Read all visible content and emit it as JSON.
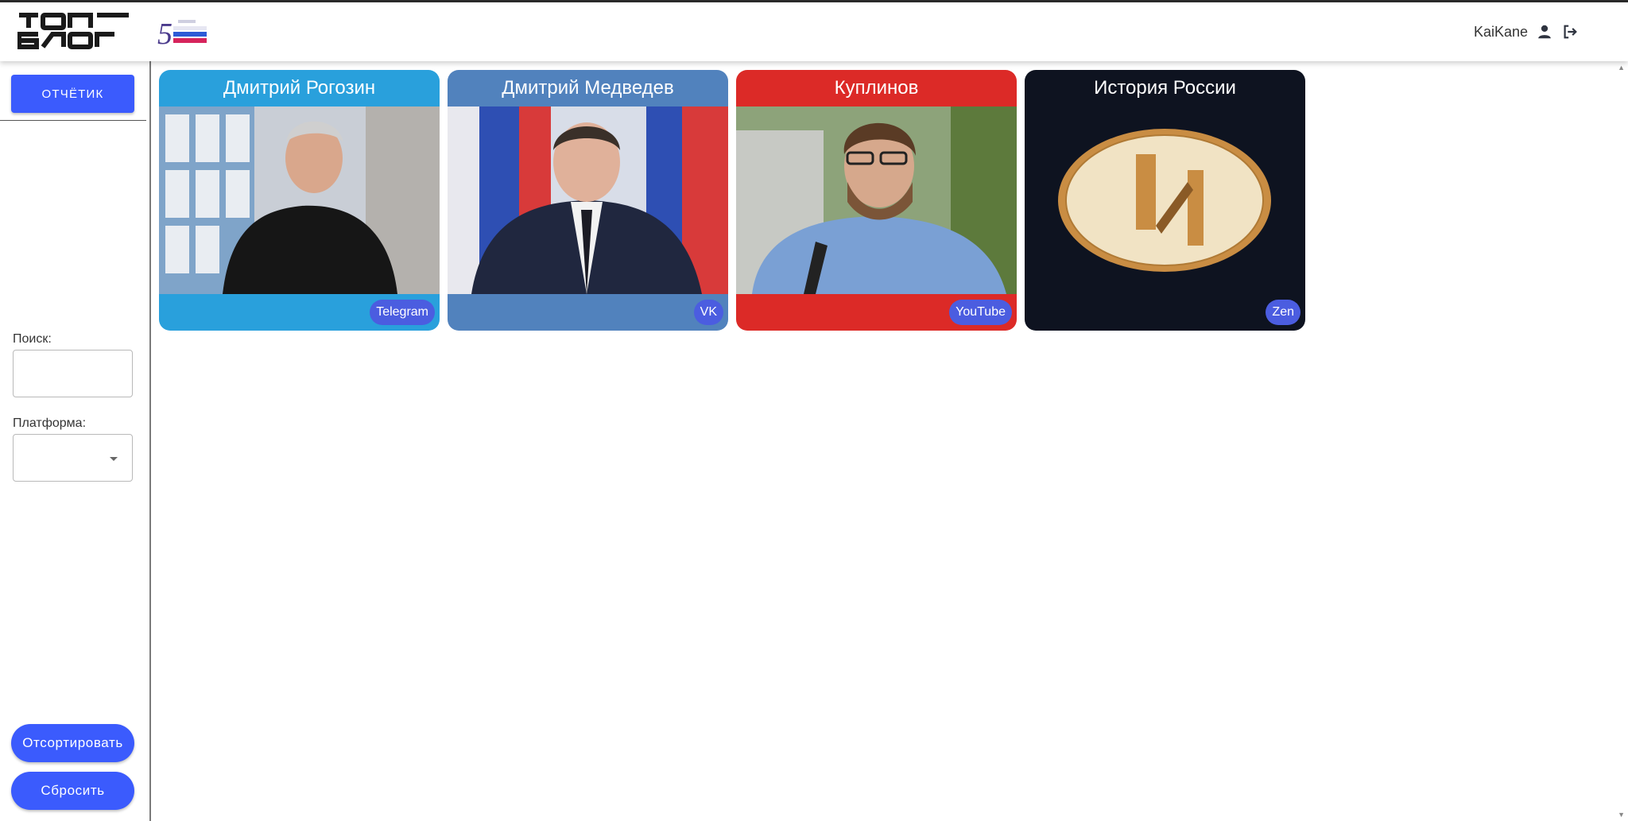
{
  "header": {
    "logo_alt": "ТОП БЛОГ",
    "badge_logo": "5 РОССИЯ СТРАНА ВОЗМОЖНОСТЕЙ",
    "username": "KaiKane",
    "user_icon": "person-icon",
    "logout_icon": "logout-icon"
  },
  "sidebar": {
    "report_label": "ОТЧЁТИК",
    "search_label": "Поиск:",
    "search_value": "",
    "platform_label": "Платформа:",
    "platform_value": "",
    "sort_label": "Отсортировать",
    "reset_label": "Сбросить"
  },
  "cards": [
    {
      "title": "Дмитрий Рогозин",
      "platform": "Telegram",
      "color": "#29a0dc"
    },
    {
      "title": "Дмитрий Медведев",
      "platform": "VK",
      "color": "#5182bd"
    },
    {
      "title": "Куплинов",
      "platform": "YouTube",
      "color": "#dc2a27"
    },
    {
      "title": "История России",
      "platform": "Zen",
      "color": "#0e1320"
    }
  ],
  "colors": {
    "accent": "#3b5bfd",
    "badge": "#4b5de0"
  }
}
